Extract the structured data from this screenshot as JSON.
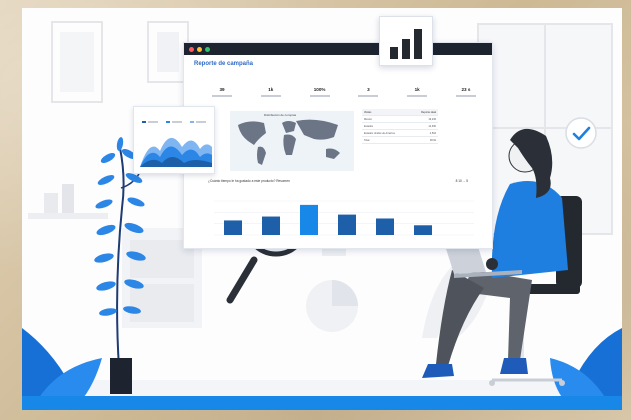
{
  "dashboard": {
    "title": "Reporte de campaña",
    "window_dots": [
      "#ff5b5b",
      "#ffc22e",
      "#2fc46b"
    ],
    "metrics": [
      {
        "value": "39"
      },
      {
        "value": "1k"
      },
      {
        "value": "100%"
      },
      {
        "value": "3"
      },
      {
        "value": "1k"
      },
      {
        "value": "23 s"
      }
    ],
    "map_label": "Distribución de compras",
    "table": {
      "headers": [
        "Visitas",
        "Reporte ideal"
      ],
      "rows": [
        [
          "México",
          "19,236"
        ],
        [
          "Estados",
          "14,930"
        ],
        [
          "Estados Unidos de América",
          "4,502"
        ],
        [
          "Total",
          "38.6k"
        ]
      ]
    },
    "question": "¿Cuánto tiempo le ha gustado a este producto?  Resumen",
    "question_right": "8  10 ... 5",
    "chart_values": [
      30,
      38,
      62,
      42,
      34,
      20
    ]
  },
  "colors": {
    "accent": "#1787e8",
    "dark_blue": "#1d5fa8",
    "map": "#6c7586",
    "chair": "#24282f"
  }
}
